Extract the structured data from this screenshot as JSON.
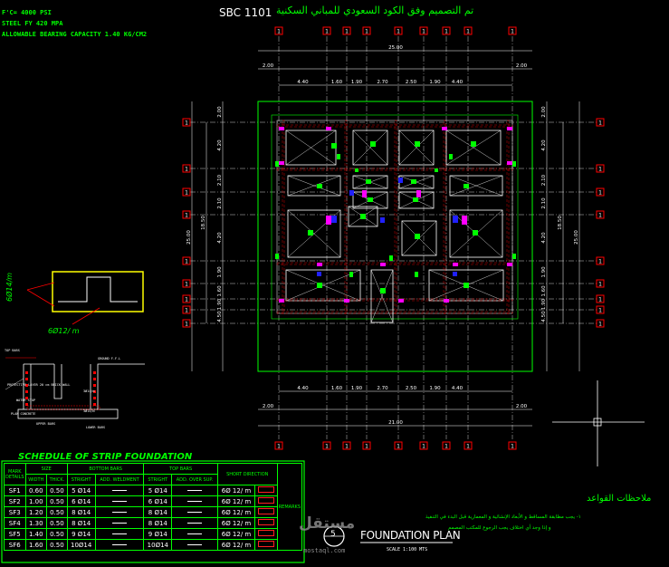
{
  "header": {
    "code_label": "SBC 1101",
    "arabic_title": "تم التصميم وفق الكود السعودي للمباني السكنية"
  },
  "notes": {
    "fc": "F'C= 4000 PSI",
    "fy": "STEEL FY 420 MPA",
    "bearing": "ALLOWABLE BEARING CAPACITY 1.40 KG/CM2"
  },
  "grid": {
    "top_dims_total": "25.00",
    "top_dims_outer": [
      "2.00",
      "2.00"
    ],
    "top_dims_inner": [
      "4.40",
      "1.60",
      "1.90",
      "2.70",
      "2.50",
      "1.90",
      "4.40"
    ],
    "bottom_dims_inner": [
      "4.40",
      "1.60",
      "1.90",
      "2.70",
      "2.50",
      "1.90",
      "4.40"
    ],
    "bottom_dims_total": "21.00",
    "bottom_dims_outer": [
      "2.00",
      "2.00"
    ],
    "left_dims": [
      "2.00",
      "4.20",
      "2.10",
      "2.10",
      "4.20",
      "1.90",
      "1.60",
      "1.90",
      "4.50"
    ],
    "side_totals": [
      "18.50",
      "25.00"
    ],
    "grid_bubble": "1"
  },
  "section": {
    "label_vertical": "6Ø14/m",
    "label_horizontal": "6Ø12/ m",
    "ground_label": "GROUND F.F.L",
    "labels": [
      "TOP BARS",
      "PROTECTIVE LAYER 20 cm BRICK WALL",
      "WATER STOP",
      "PLAN CONCRETE",
      "UPPER BARS",
      "LOWER BARS",
      "3Ø14/m",
      "3Ø14/m"
    ]
  },
  "schedule": {
    "title": "SCHEDULE OF STRIP FOUNDATION",
    "headers": {
      "mark": "MARK DETAILS",
      "size": "SIZE",
      "bottom": "BOTTOM BARS",
      "top": "TOP BARS",
      "short": "SHORT DIRECTION",
      "remarks": "REMARKS",
      "width": "WIDTH",
      "thick": "THICK.",
      "straight": "STRIGHT",
      "add": "ADD. WELDMENT",
      "straight2": "STRIGHT",
      "add2": "ADD. OVER SUP."
    },
    "rows": [
      {
        "mark": "SF1",
        "width": "0.60",
        "thick": "0.50",
        "bottom": "5 Ø14",
        "top": "5 Ø14",
        "short": "6Ø 12/ m"
      },
      {
        "mark": "SF2",
        "width": "1.00",
        "thick": "0.50",
        "bottom": "6 Ø14",
        "top": "6 Ø14",
        "short": "6Ø 12/ m"
      },
      {
        "mark": "SF3",
        "width": "1.20",
        "thick": "0.50",
        "bottom": "8 Ø14",
        "top": "8 Ø14",
        "short": "6Ø 12/ m"
      },
      {
        "mark": "SF4",
        "width": "1.30",
        "thick": "0.50",
        "bottom": "8 Ø14",
        "top": "8 Ø14",
        "short": "6Ø 12/ m"
      },
      {
        "mark": "SF5",
        "width": "1.40",
        "thick": "0.50",
        "bottom": "9 Ø14",
        "top": "9 Ø14",
        "short": "6Ø 12/ m"
      },
      {
        "mark": "SF6",
        "width": "1.60",
        "thick": "0.50",
        "bottom": "10Ø14",
        "top": "10Ø14",
        "short": "6Ø 12/ m"
      }
    ]
  },
  "arabic_notes": {
    "title": "ملاحظات القواعد",
    "line1": "١- يجب مطابقة المساقط و الأبعاد الإنشائية و المعمارية قبل البدء في التنفيذ",
    "line2": "و إذا وجد أي اختلاف يجب الرجوع للمكتب المصمم"
  },
  "plan_title": {
    "title": "FOUNDATION PLAN",
    "scale": "SCALE 1:100 MTS",
    "seal_number": "5"
  },
  "watermark": {
    "brand": "مستقل",
    "url": "mostaql.com"
  },
  "colors": {
    "background": "#000000",
    "green": "#00ff00",
    "red": "#ff0000",
    "magenta": "#ff00ff",
    "blue": "#2020ff",
    "white": "#ffffff"
  }
}
